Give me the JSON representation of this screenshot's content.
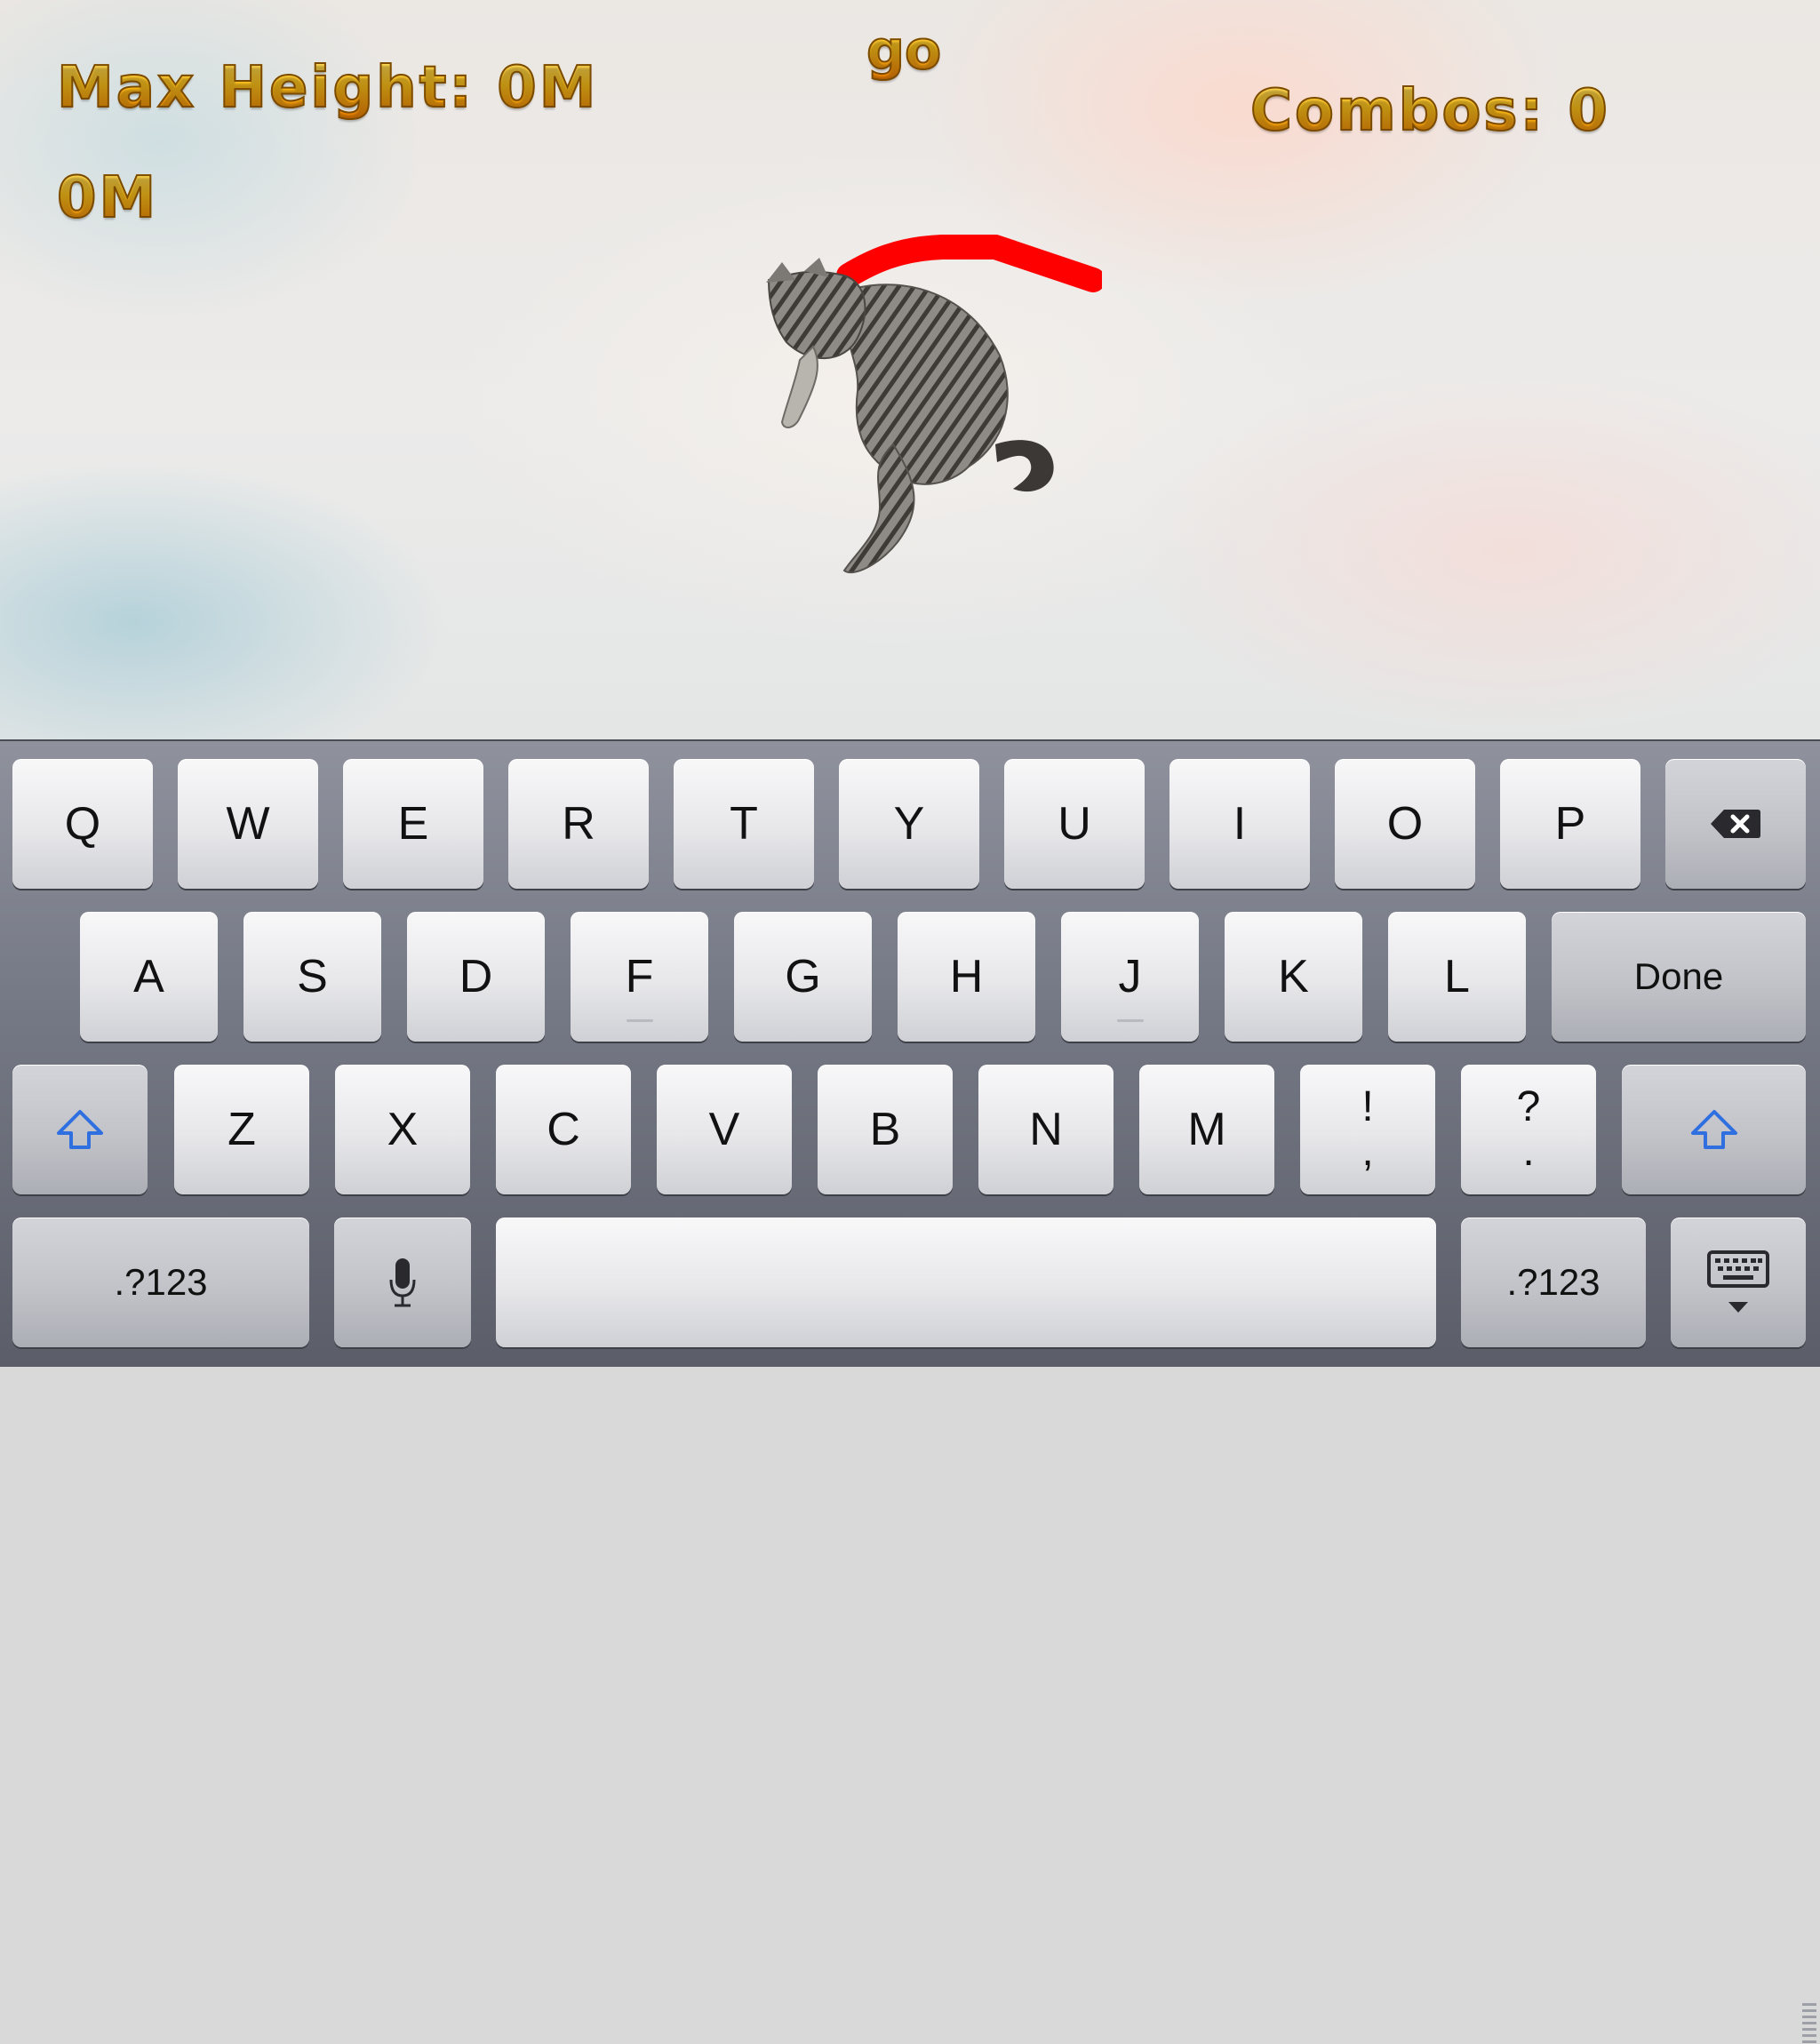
{
  "hud": {
    "max_height": "Max Height: 0M",
    "status": "go",
    "combos": "Combos: 0",
    "current_height": "0M"
  },
  "colors": {
    "hud_gold": "#ffc21a",
    "trail_red": "#ff0000",
    "shift_blue": "#2f6fe0"
  },
  "keyboard": {
    "row1": [
      "Q",
      "W",
      "E",
      "R",
      "T",
      "Y",
      "U",
      "I",
      "O",
      "P"
    ],
    "row2": [
      "A",
      "S",
      "D",
      "F",
      "G",
      "H",
      "J",
      "K",
      "L"
    ],
    "row3": [
      "Z",
      "X",
      "C",
      "V",
      "B",
      "N",
      "M"
    ],
    "punct1": {
      "top": "!",
      "bottom": ","
    },
    "punct2": {
      "top": "?",
      "bottom": "."
    },
    "done_label": "Done",
    "numbers_label": ".?123",
    "icons": {
      "backspace": "backspace-icon",
      "shift": "shift-icon",
      "mic": "microphone-icon",
      "dismiss": "keyboard-dismiss-icon"
    }
  }
}
